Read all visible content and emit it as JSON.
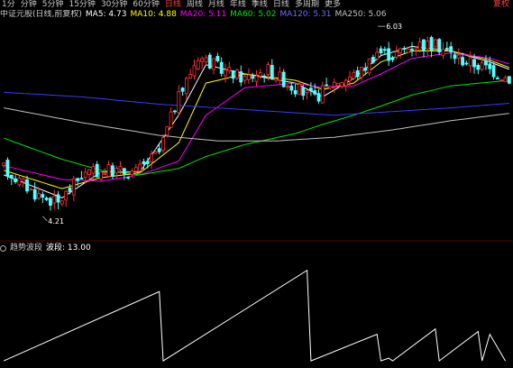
{
  "toolbar": {
    "periods": [
      "1分",
      "分钟",
      "5分钟",
      "15分钟",
      "30分钟",
      "60分钟",
      "日线",
      "周线",
      "月线",
      "年线",
      "季线",
      "日线",
      "多周期",
      "更多"
    ],
    "active_index": 6,
    "right_button": "复权"
  },
  "infobar": {
    "title": "中证元股(日线,前复权)",
    "ma5": "MA5: 4.73",
    "ma10": "MA10: 4.88",
    "ma20": "MA20: 5.11",
    "ma60": "MA60: 5.02",
    "ma120": "MA120: 5.31",
    "ma250": "MA250: 5.06"
  },
  "subinfo": {
    "title": "趋势波段",
    "value": "波段: 13.00"
  },
  "colors": {
    "up": "#ff3232",
    "down": "#54ffff",
    "ma5": "#ffffff",
    "ma10": "#ffff00",
    "ma20": "#ff00ff",
    "ma60": "#00e600",
    "ma120": "#3b3bff",
    "ma250": "#c0c0c0"
  },
  "chart_data": [
    {
      "type": "candlestick",
      "price_range": [
        3.9,
        6.2
      ],
      "annotations": [
        {
          "text": "6.03",
          "kind": "high"
        },
        {
          "text": "4.21",
          "kind": "low"
        }
      ],
      "waypoints": [
        [
          0,
          4.62
        ],
        [
          8,
          4.35
        ],
        [
          14,
          4.24
        ],
        [
          20,
          4.55
        ],
        [
          26,
          4.6
        ],
        [
          34,
          4.58
        ],
        [
          40,
          4.8
        ],
        [
          44,
          5.3
        ],
        [
          50,
          5.85
        ],
        [
          56,
          5.7
        ],
        [
          62,
          5.6
        ],
        [
          68,
          5.7
        ],
        [
          74,
          5.52
        ],
        [
          80,
          5.38
        ],
        [
          84,
          5.55
        ],
        [
          88,
          5.6
        ],
        [
          92,
          5.68
        ],
        [
          96,
          5.9
        ],
        [
          100,
          5.85
        ],
        [
          106,
          5.98
        ],
        [
          112,
          5.95
        ],
        [
          118,
          5.8
        ],
        [
          124,
          5.72
        ],
        [
          130,
          5.6
        ]
      ],
      "ma_lines": [
        {
          "name": "MA5",
          "value_points": [
            [
              0,
              4.55
            ],
            [
              15,
              4.3
            ],
            [
              25,
              4.58
            ],
            [
              35,
              4.58
            ],
            [
              45,
              5.2
            ],
            [
              52,
              5.75
            ],
            [
              62,
              5.65
            ],
            [
              75,
              5.55
            ],
            [
              82,
              5.4
            ],
            [
              90,
              5.6
            ],
            [
              97,
              5.85
            ],
            [
              105,
              5.95
            ],
            [
              115,
              5.9
            ],
            [
              125,
              5.78
            ],
            [
              130,
              5.7
            ]
          ]
        },
        {
          "name": "MA10",
          "value_points": [
            [
              0,
              4.6
            ],
            [
              15,
              4.4
            ],
            [
              25,
              4.52
            ],
            [
              35,
              4.57
            ],
            [
              45,
              4.9
            ],
            [
              52,
              5.55
            ],
            [
              62,
              5.65
            ],
            [
              75,
              5.58
            ],
            [
              82,
              5.48
            ],
            [
              90,
              5.55
            ],
            [
              97,
              5.78
            ],
            [
              105,
              5.9
            ],
            [
              115,
              5.9
            ],
            [
              125,
              5.8
            ],
            [
              130,
              5.72
            ]
          ]
        },
        {
          "name": "MA20",
          "value_points": [
            [
              0,
              4.65
            ],
            [
              15,
              4.5
            ],
            [
              25,
              4.48
            ],
            [
              35,
              4.55
            ],
            [
              45,
              4.7
            ],
            [
              52,
              5.2
            ],
            [
              62,
              5.5
            ],
            [
              75,
              5.55
            ],
            [
              82,
              5.5
            ],
            [
              90,
              5.52
            ],
            [
              97,
              5.65
            ],
            [
              105,
              5.82
            ],
            [
              115,
              5.88
            ],
            [
              125,
              5.82
            ],
            [
              130,
              5.76
            ]
          ]
        },
        {
          "name": "MA60",
          "value_points": [
            [
              0,
              4.95
            ],
            [
              15,
              4.72
            ],
            [
              25,
              4.6
            ],
            [
              35,
              4.55
            ],
            [
              45,
              4.62
            ],
            [
              52,
              4.75
            ],
            [
              62,
              4.88
            ],
            [
              75,
              5.0
            ],
            [
              82,
              5.1
            ],
            [
              90,
              5.2
            ],
            [
              97,
              5.3
            ],
            [
              105,
              5.42
            ],
            [
              115,
              5.52
            ],
            [
              125,
              5.56
            ],
            [
              130,
              5.58
            ]
          ]
        },
        {
          "name": "MA120",
          "value_points": [
            [
              0,
              5.45
            ],
            [
              20,
              5.4
            ],
            [
              40,
              5.32
            ],
            [
              55,
              5.28
            ],
            [
              70,
              5.24
            ],
            [
              85,
              5.2
            ],
            [
              100,
              5.24
            ],
            [
              115,
              5.28
            ],
            [
              130,
              5.33
            ]
          ]
        },
        {
          "name": "MA250",
          "value_points": [
            [
              0,
              5.28
            ],
            [
              20,
              5.12
            ],
            [
              40,
              4.98
            ],
            [
              55,
              4.92
            ],
            [
              70,
              4.92
            ],
            [
              85,
              4.96
            ],
            [
              100,
              5.04
            ],
            [
              115,
              5.14
            ],
            [
              130,
              5.22
            ]
          ]
        }
      ]
    },
    {
      "type": "line",
      "name": "趋势波段",
      "value_range": [
        0,
        21
      ],
      "points": [
        [
          0,
          1
        ],
        [
          40,
          14
        ],
        [
          41,
          1
        ],
        [
          78,
          18
        ],
        [
          79,
          1
        ],
        [
          96,
          6
        ],
        [
          97,
          1
        ],
        [
          99,
          1.5
        ],
        [
          100,
          1
        ],
        [
          111,
          7
        ],
        [
          112,
          1
        ],
        [
          122,
          6.5
        ],
        [
          123,
          1
        ],
        [
          125,
          6
        ],
        [
          129,
          1
        ]
      ]
    }
  ]
}
